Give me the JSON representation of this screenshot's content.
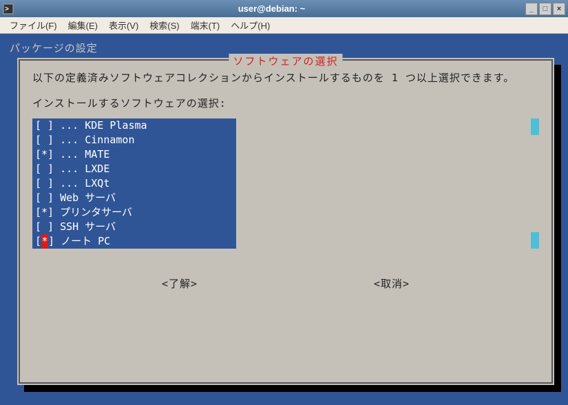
{
  "window": {
    "title": "user@debian: ~",
    "buttons": {
      "minimize": "_",
      "maximize": "□",
      "close": "×"
    }
  },
  "menubar": {
    "items": [
      "ファイル(F)",
      "編集(E)",
      "表示(V)",
      "検索(S)",
      "端末(T)",
      "ヘルプ(H)"
    ]
  },
  "tui": {
    "header": "パッケージの設定",
    "dialog_title": "ソフトウェアの選択",
    "instruction": "以下の定義済みソフトウェアコレクションからインストールするものを 1 つ以上選択できます。",
    "prompt": "インストールするソフトウェアの選択:",
    "list": [
      {
        "checked": false,
        "label": "... KDE Plasma",
        "cursor": false
      },
      {
        "checked": false,
        "label": "... Cinnamon",
        "cursor": false
      },
      {
        "checked": true,
        "label": "... MATE",
        "cursor": false
      },
      {
        "checked": false,
        "label": "... LXDE",
        "cursor": false
      },
      {
        "checked": false,
        "label": "... LXQt",
        "cursor": false
      },
      {
        "checked": false,
        "label": "Web サーバ",
        "cursor": false
      },
      {
        "checked": true,
        "label": "プリンタサーバ",
        "cursor": false
      },
      {
        "checked": false,
        "label": "SSH サーバ",
        "cursor": false
      },
      {
        "checked": true,
        "label": "ノート PC",
        "cursor": true
      }
    ],
    "ok": "<了解>",
    "cancel": "<取消>"
  }
}
